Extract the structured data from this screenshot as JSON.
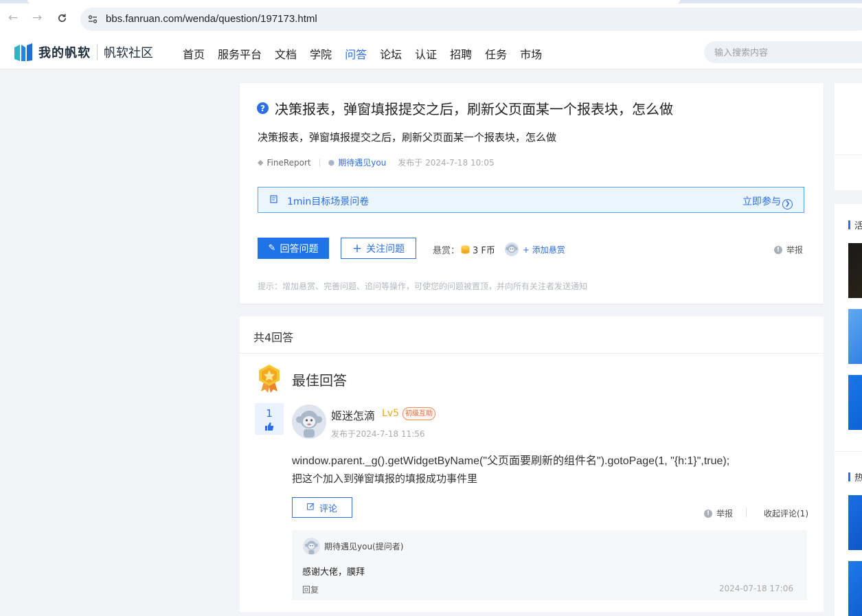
{
  "browser": {
    "url": "bbs.fanruan.com/wenda/question/197173.html"
  },
  "site": {
    "brand": "我的帆软",
    "community": "帆软社区",
    "nav": [
      "首页",
      "服务平台",
      "文档",
      "学院",
      "问答",
      "论坛",
      "认证",
      "招聘",
      "任务",
      "市场"
    ],
    "active_nav": "问答",
    "search_placeholder": "输入搜索内容",
    "accent_color": "#2c6ee6"
  },
  "question": {
    "title": "决策报表，弹窗填报提交之后，刷新父页面某一个报表块，怎么做",
    "description": "决策报表，弹窗填报提交之后，刷新父页面某一个报表块，怎么做",
    "tag": "FineReport",
    "author": "期待遇见you",
    "posted": "发布于 2024-7-18 10:05",
    "survey_text": "1min目标场景问卷",
    "survey_link": "立即参与",
    "answer_button": "回答问题",
    "follow_button": "关注问题",
    "bounty_label": "悬赏：",
    "bounty_amount": "3 F币",
    "add_bounty": "+ 添加悬赏",
    "report": "举报",
    "tip": "提示：增加悬赏、完善问题、追问等操作，可使您的问题被置顶，并向所有关注者发送通知"
  },
  "answers": {
    "count_label": "共4回答",
    "best_label": "最佳回答",
    "best": {
      "votes": "1",
      "author": "姬迷怎滴",
      "level": "Lv5",
      "badge": "初级互助",
      "date": "发布于2024-7-18 11:56",
      "code": "window.parent._g().getWidgetByName(\"父页面要刷新的组件名\").gotoPage(1, \"{h:1}\",true);",
      "text": "把这个加入到弹窗填报的填报成功事件里",
      "comment_button": "评论",
      "report": "举报",
      "collapse": "收起评论(1)",
      "comment": {
        "author": "期待遇见you(提问者)",
        "text": "感谢大佬，膜拜",
        "reply": "回复",
        "date": "2024-07-18 17:06"
      }
    }
  },
  "sidebar": {
    "head1": "活",
    "head2": "热"
  }
}
